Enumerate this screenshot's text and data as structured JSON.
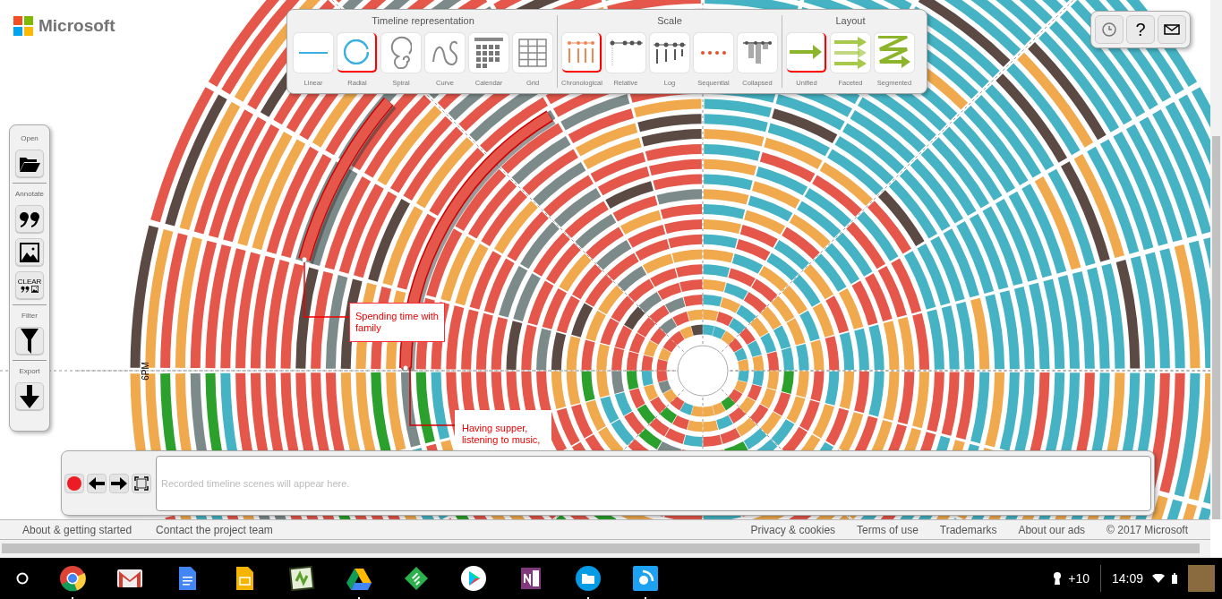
{
  "brand": {
    "name": "Microsoft"
  },
  "toolbar": {
    "sections": [
      {
        "title": "Timeline representation",
        "options": [
          {
            "label": "Linear",
            "selected": false
          },
          {
            "label": "Radial",
            "selected": true
          },
          {
            "label": "Spiral",
            "selected": false
          },
          {
            "label": "Curve",
            "selected": false
          },
          {
            "label": "Calendar",
            "selected": false
          },
          {
            "label": "Grid",
            "selected": false
          }
        ]
      },
      {
        "title": "Scale",
        "options": [
          {
            "label": "Chronological",
            "selected": true
          },
          {
            "label": "Relative",
            "selected": false
          },
          {
            "label": "Log",
            "selected": false
          },
          {
            "label": "Sequential",
            "selected": false
          },
          {
            "label": "Collapsed",
            "selected": false
          }
        ]
      },
      {
        "title": "Layout",
        "options": [
          {
            "label": "Unified",
            "selected": true
          },
          {
            "label": "Faceted",
            "selected": false
          },
          {
            "label": "Segmented",
            "selected": false
          }
        ]
      }
    ]
  },
  "top_buttons": [
    {
      "kind": "clock"
    },
    {
      "kind": "help",
      "label": "?"
    },
    {
      "kind": "mail"
    }
  ],
  "left_toolbar": [
    {
      "title": "Open",
      "buttons": [
        {
          "kind": "folder"
        }
      ]
    },
    {
      "title": "Annotate",
      "buttons": [
        {
          "kind": "quote"
        },
        {
          "kind": "image"
        },
        {
          "kind": "clear",
          "label": "CLEAR"
        }
      ]
    },
    {
      "title": "Filter",
      "buttons": [
        {
          "kind": "filter"
        }
      ]
    },
    {
      "title": "Export",
      "buttons": [
        {
          "kind": "download"
        }
      ]
    }
  ],
  "chart": {
    "axis_label": "6PM",
    "annotations": [
      {
        "text": "Spending time with family"
      },
      {
        "text": "Having supper, listening to music,"
      }
    ]
  },
  "recorder": {
    "buttons": [
      {
        "kind": "record"
      },
      {
        "kind": "back"
      },
      {
        "kind": "forward"
      },
      {
        "kind": "fullscreen"
      }
    ],
    "placeholder": "Recorded timeline scenes will appear here."
  },
  "footer": {
    "left_links": [
      "About & getting started",
      "Contact the project team"
    ],
    "right_links": [
      "Privacy & cookies",
      "Terms of use",
      "Trademarks",
      "About our ads"
    ],
    "copyright": "© 2017 Microsoft"
  },
  "taskbar": {
    "apps": [
      {
        "kind": "chrome",
        "running": true
      },
      {
        "kind": "gmail",
        "running": false
      },
      {
        "kind": "docs",
        "running": false
      },
      {
        "kind": "slides",
        "running": false
      },
      {
        "kind": "green",
        "running": false
      },
      {
        "kind": "drive",
        "running": true
      },
      {
        "kind": "feedly",
        "running": false
      },
      {
        "kind": "play",
        "running": false
      },
      {
        "kind": "onenote",
        "running": false
      },
      {
        "kind": "files",
        "running": true
      },
      {
        "kind": "rss",
        "running": true
      }
    ],
    "notifications": "+10",
    "time": "14:09"
  }
}
